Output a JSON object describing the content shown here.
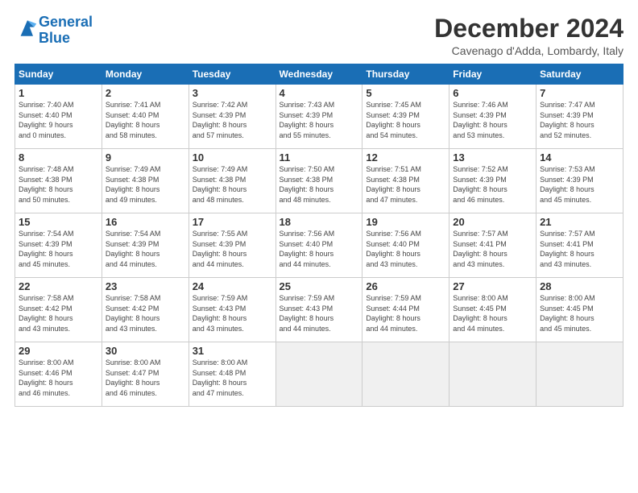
{
  "header": {
    "logo_line1": "General",
    "logo_line2": "Blue",
    "month": "December 2024",
    "location": "Cavenago d'Adda, Lombardy, Italy"
  },
  "weekdays": [
    "Sunday",
    "Monday",
    "Tuesday",
    "Wednesday",
    "Thursday",
    "Friday",
    "Saturday"
  ],
  "weeks": [
    [
      {
        "day": "1",
        "info": "Sunrise: 7:40 AM\nSunset: 4:40 PM\nDaylight: 9 hours\nand 0 minutes."
      },
      {
        "day": "2",
        "info": "Sunrise: 7:41 AM\nSunset: 4:40 PM\nDaylight: 8 hours\nand 58 minutes."
      },
      {
        "day": "3",
        "info": "Sunrise: 7:42 AM\nSunset: 4:39 PM\nDaylight: 8 hours\nand 57 minutes."
      },
      {
        "day": "4",
        "info": "Sunrise: 7:43 AM\nSunset: 4:39 PM\nDaylight: 8 hours\nand 55 minutes."
      },
      {
        "day": "5",
        "info": "Sunrise: 7:45 AM\nSunset: 4:39 PM\nDaylight: 8 hours\nand 54 minutes."
      },
      {
        "day": "6",
        "info": "Sunrise: 7:46 AM\nSunset: 4:39 PM\nDaylight: 8 hours\nand 53 minutes."
      },
      {
        "day": "7",
        "info": "Sunrise: 7:47 AM\nSunset: 4:39 PM\nDaylight: 8 hours\nand 52 minutes."
      }
    ],
    [
      {
        "day": "8",
        "info": "Sunrise: 7:48 AM\nSunset: 4:38 PM\nDaylight: 8 hours\nand 50 minutes."
      },
      {
        "day": "9",
        "info": "Sunrise: 7:49 AM\nSunset: 4:38 PM\nDaylight: 8 hours\nand 49 minutes."
      },
      {
        "day": "10",
        "info": "Sunrise: 7:49 AM\nSunset: 4:38 PM\nDaylight: 8 hours\nand 48 minutes."
      },
      {
        "day": "11",
        "info": "Sunrise: 7:50 AM\nSunset: 4:38 PM\nDaylight: 8 hours\nand 48 minutes."
      },
      {
        "day": "12",
        "info": "Sunrise: 7:51 AM\nSunset: 4:38 PM\nDaylight: 8 hours\nand 47 minutes."
      },
      {
        "day": "13",
        "info": "Sunrise: 7:52 AM\nSunset: 4:39 PM\nDaylight: 8 hours\nand 46 minutes."
      },
      {
        "day": "14",
        "info": "Sunrise: 7:53 AM\nSunset: 4:39 PM\nDaylight: 8 hours\nand 45 minutes."
      }
    ],
    [
      {
        "day": "15",
        "info": "Sunrise: 7:54 AM\nSunset: 4:39 PM\nDaylight: 8 hours\nand 45 minutes."
      },
      {
        "day": "16",
        "info": "Sunrise: 7:54 AM\nSunset: 4:39 PM\nDaylight: 8 hours\nand 44 minutes."
      },
      {
        "day": "17",
        "info": "Sunrise: 7:55 AM\nSunset: 4:39 PM\nDaylight: 8 hours\nand 44 minutes."
      },
      {
        "day": "18",
        "info": "Sunrise: 7:56 AM\nSunset: 4:40 PM\nDaylight: 8 hours\nand 44 minutes."
      },
      {
        "day": "19",
        "info": "Sunrise: 7:56 AM\nSunset: 4:40 PM\nDaylight: 8 hours\nand 43 minutes."
      },
      {
        "day": "20",
        "info": "Sunrise: 7:57 AM\nSunset: 4:41 PM\nDaylight: 8 hours\nand 43 minutes."
      },
      {
        "day": "21",
        "info": "Sunrise: 7:57 AM\nSunset: 4:41 PM\nDaylight: 8 hours\nand 43 minutes."
      }
    ],
    [
      {
        "day": "22",
        "info": "Sunrise: 7:58 AM\nSunset: 4:42 PM\nDaylight: 8 hours\nand 43 minutes."
      },
      {
        "day": "23",
        "info": "Sunrise: 7:58 AM\nSunset: 4:42 PM\nDaylight: 8 hours\nand 43 minutes."
      },
      {
        "day": "24",
        "info": "Sunrise: 7:59 AM\nSunset: 4:43 PM\nDaylight: 8 hours\nand 43 minutes."
      },
      {
        "day": "25",
        "info": "Sunrise: 7:59 AM\nSunset: 4:43 PM\nDaylight: 8 hours\nand 44 minutes."
      },
      {
        "day": "26",
        "info": "Sunrise: 7:59 AM\nSunset: 4:44 PM\nDaylight: 8 hours\nand 44 minutes."
      },
      {
        "day": "27",
        "info": "Sunrise: 8:00 AM\nSunset: 4:45 PM\nDaylight: 8 hours\nand 44 minutes."
      },
      {
        "day": "28",
        "info": "Sunrise: 8:00 AM\nSunset: 4:45 PM\nDaylight: 8 hours\nand 45 minutes."
      }
    ],
    [
      {
        "day": "29",
        "info": "Sunrise: 8:00 AM\nSunset: 4:46 PM\nDaylight: 8 hours\nand 46 minutes."
      },
      {
        "day": "30",
        "info": "Sunrise: 8:00 AM\nSunset: 4:47 PM\nDaylight: 8 hours\nand 46 minutes."
      },
      {
        "day": "31",
        "info": "Sunrise: 8:00 AM\nSunset: 4:48 PM\nDaylight: 8 hours\nand 47 minutes."
      },
      null,
      null,
      null,
      null
    ]
  ]
}
